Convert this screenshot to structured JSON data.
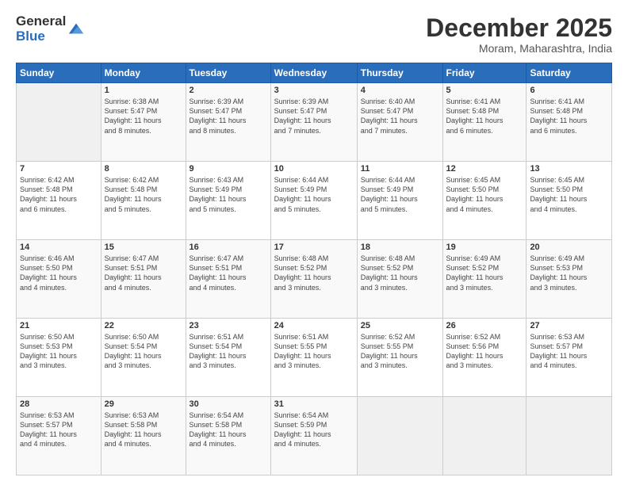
{
  "logo": {
    "general": "General",
    "blue": "Blue"
  },
  "title": "December 2025",
  "location": "Moram, Maharashtra, India",
  "days_of_week": [
    "Sunday",
    "Monday",
    "Tuesday",
    "Wednesday",
    "Thursday",
    "Friday",
    "Saturday"
  ],
  "weeks": [
    [
      {
        "day": "",
        "info": ""
      },
      {
        "day": "1",
        "info": "Sunrise: 6:38 AM\nSunset: 5:47 PM\nDaylight: 11 hours\nand 8 minutes."
      },
      {
        "day": "2",
        "info": "Sunrise: 6:39 AM\nSunset: 5:47 PM\nDaylight: 11 hours\nand 8 minutes."
      },
      {
        "day": "3",
        "info": "Sunrise: 6:39 AM\nSunset: 5:47 PM\nDaylight: 11 hours\nand 7 minutes."
      },
      {
        "day": "4",
        "info": "Sunrise: 6:40 AM\nSunset: 5:47 PM\nDaylight: 11 hours\nand 7 minutes."
      },
      {
        "day": "5",
        "info": "Sunrise: 6:41 AM\nSunset: 5:48 PM\nDaylight: 11 hours\nand 6 minutes."
      },
      {
        "day": "6",
        "info": "Sunrise: 6:41 AM\nSunset: 5:48 PM\nDaylight: 11 hours\nand 6 minutes."
      }
    ],
    [
      {
        "day": "7",
        "info": "Sunrise: 6:42 AM\nSunset: 5:48 PM\nDaylight: 11 hours\nand 6 minutes."
      },
      {
        "day": "8",
        "info": "Sunrise: 6:42 AM\nSunset: 5:48 PM\nDaylight: 11 hours\nand 5 minutes."
      },
      {
        "day": "9",
        "info": "Sunrise: 6:43 AM\nSunset: 5:49 PM\nDaylight: 11 hours\nand 5 minutes."
      },
      {
        "day": "10",
        "info": "Sunrise: 6:44 AM\nSunset: 5:49 PM\nDaylight: 11 hours\nand 5 minutes."
      },
      {
        "day": "11",
        "info": "Sunrise: 6:44 AM\nSunset: 5:49 PM\nDaylight: 11 hours\nand 5 minutes."
      },
      {
        "day": "12",
        "info": "Sunrise: 6:45 AM\nSunset: 5:50 PM\nDaylight: 11 hours\nand 4 minutes."
      },
      {
        "day": "13",
        "info": "Sunrise: 6:45 AM\nSunset: 5:50 PM\nDaylight: 11 hours\nand 4 minutes."
      }
    ],
    [
      {
        "day": "14",
        "info": "Sunrise: 6:46 AM\nSunset: 5:50 PM\nDaylight: 11 hours\nand 4 minutes."
      },
      {
        "day": "15",
        "info": "Sunrise: 6:47 AM\nSunset: 5:51 PM\nDaylight: 11 hours\nand 4 minutes."
      },
      {
        "day": "16",
        "info": "Sunrise: 6:47 AM\nSunset: 5:51 PM\nDaylight: 11 hours\nand 4 minutes."
      },
      {
        "day": "17",
        "info": "Sunrise: 6:48 AM\nSunset: 5:52 PM\nDaylight: 11 hours\nand 3 minutes."
      },
      {
        "day": "18",
        "info": "Sunrise: 6:48 AM\nSunset: 5:52 PM\nDaylight: 11 hours\nand 3 minutes."
      },
      {
        "day": "19",
        "info": "Sunrise: 6:49 AM\nSunset: 5:52 PM\nDaylight: 11 hours\nand 3 minutes."
      },
      {
        "day": "20",
        "info": "Sunrise: 6:49 AM\nSunset: 5:53 PM\nDaylight: 11 hours\nand 3 minutes."
      }
    ],
    [
      {
        "day": "21",
        "info": "Sunrise: 6:50 AM\nSunset: 5:53 PM\nDaylight: 11 hours\nand 3 minutes."
      },
      {
        "day": "22",
        "info": "Sunrise: 6:50 AM\nSunset: 5:54 PM\nDaylight: 11 hours\nand 3 minutes."
      },
      {
        "day": "23",
        "info": "Sunrise: 6:51 AM\nSunset: 5:54 PM\nDaylight: 11 hours\nand 3 minutes."
      },
      {
        "day": "24",
        "info": "Sunrise: 6:51 AM\nSunset: 5:55 PM\nDaylight: 11 hours\nand 3 minutes."
      },
      {
        "day": "25",
        "info": "Sunrise: 6:52 AM\nSunset: 5:55 PM\nDaylight: 11 hours\nand 3 minutes."
      },
      {
        "day": "26",
        "info": "Sunrise: 6:52 AM\nSunset: 5:56 PM\nDaylight: 11 hours\nand 3 minutes."
      },
      {
        "day": "27",
        "info": "Sunrise: 6:53 AM\nSunset: 5:57 PM\nDaylight: 11 hours\nand 4 minutes."
      }
    ],
    [
      {
        "day": "28",
        "info": "Sunrise: 6:53 AM\nSunset: 5:57 PM\nDaylight: 11 hours\nand 4 minutes."
      },
      {
        "day": "29",
        "info": "Sunrise: 6:53 AM\nSunset: 5:58 PM\nDaylight: 11 hours\nand 4 minutes."
      },
      {
        "day": "30",
        "info": "Sunrise: 6:54 AM\nSunset: 5:58 PM\nDaylight: 11 hours\nand 4 minutes."
      },
      {
        "day": "31",
        "info": "Sunrise: 6:54 AM\nSunset: 5:59 PM\nDaylight: 11 hours\nand 4 minutes."
      },
      {
        "day": "",
        "info": ""
      },
      {
        "day": "",
        "info": ""
      },
      {
        "day": "",
        "info": ""
      }
    ]
  ]
}
